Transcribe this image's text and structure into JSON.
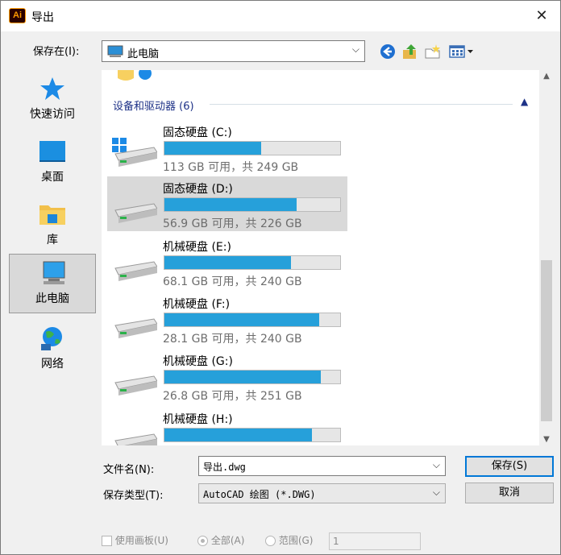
{
  "window": {
    "title": "导出",
    "app_badge": "Ai"
  },
  "save_in": {
    "label": "保存在(I):",
    "value": "此电脑"
  },
  "places": [
    {
      "label": "快速访问"
    },
    {
      "label": "桌面"
    },
    {
      "label": "库"
    },
    {
      "label": "此电脑"
    },
    {
      "label": "网络"
    }
  ],
  "group": {
    "header": "设备和驱动器 (6)"
  },
  "drives": [
    {
      "name": "固态硬盘 (C:)",
      "usage": "113 GB 可用，共 249 GB",
      "fill_percent": 55
    },
    {
      "name": "固态硬盘 (D:)",
      "usage": "56.9 GB 可用，共 226 GB",
      "fill_percent": 75
    },
    {
      "name": "机械硬盘 (E:)",
      "usage": "68.1 GB 可用，共 240 GB",
      "fill_percent": 72
    },
    {
      "name": "机械硬盘 (F:)",
      "usage": "28.1 GB 可用，共 240 GB",
      "fill_percent": 88
    },
    {
      "name": "机械硬盘 (G:)",
      "usage": "26.8 GB 可用，共 251 GB",
      "fill_percent": 89
    },
    {
      "name": "机械硬盘 (H:)",
      "usage": "",
      "fill_percent": 84
    }
  ],
  "file_name": {
    "label": "文件名(N):",
    "value": "导出.dwg"
  },
  "file_type": {
    "label": "保存类型(T):",
    "value": "AutoCAD 绘图 (*.DWG)"
  },
  "buttons": {
    "save": "保存(S)",
    "cancel": "取消"
  },
  "options": {
    "use_artboards": "使用画板(U)",
    "all": "全部(A)",
    "range": "范围(G)",
    "range_value": "1"
  },
  "colors": {
    "accent": "#26a0da",
    "group_header": "#1e3287"
  }
}
